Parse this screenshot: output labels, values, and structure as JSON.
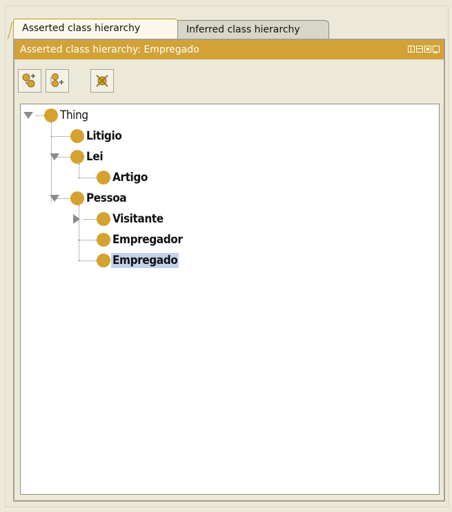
{
  "tabs": [
    {
      "label": "Asserted class hierarchy",
      "active": true
    },
    {
      "label": "Inferred class hierarchy",
      "active": false
    }
  ],
  "panel": {
    "title": "Asserted class hierarchy: Empregado",
    "title_bg": "#d3a237",
    "window_buttons": [
      "tile-vertical-icon",
      "tile-horizontal-icon",
      "maximize-icon",
      "close-icon"
    ]
  },
  "toolbar": {
    "buttons": [
      {
        "name": "add-subclass-button",
        "icon": "add-subclass-icon"
      },
      {
        "name": "add-sibling-button",
        "icon": "add-sibling-class-icon"
      },
      {
        "name": "delete-class-button",
        "icon": "delete-class-icon"
      }
    ]
  },
  "tree": {
    "nodes": [
      {
        "label": "Thing",
        "depth": 0,
        "expanded": true,
        "bold": false
      },
      {
        "label": "Litigio",
        "depth": 1,
        "bold": true
      },
      {
        "label": "Lei",
        "depth": 1,
        "expanded": true,
        "bold": true
      },
      {
        "label": "Artigo",
        "depth": 2,
        "bold": true
      },
      {
        "label": "Pessoa",
        "depth": 1,
        "expanded": true,
        "bold": true
      },
      {
        "label": "Visitante",
        "depth": 2,
        "expanded": false,
        "bold": true
      },
      {
        "label": "Empregador",
        "depth": 2,
        "bold": true
      },
      {
        "label": "Empregado",
        "depth": 2,
        "bold": true,
        "selected": true
      }
    ],
    "selected": "Empregado",
    "node_color": "#d4a22e",
    "selection_color": "#c2d2e8"
  }
}
